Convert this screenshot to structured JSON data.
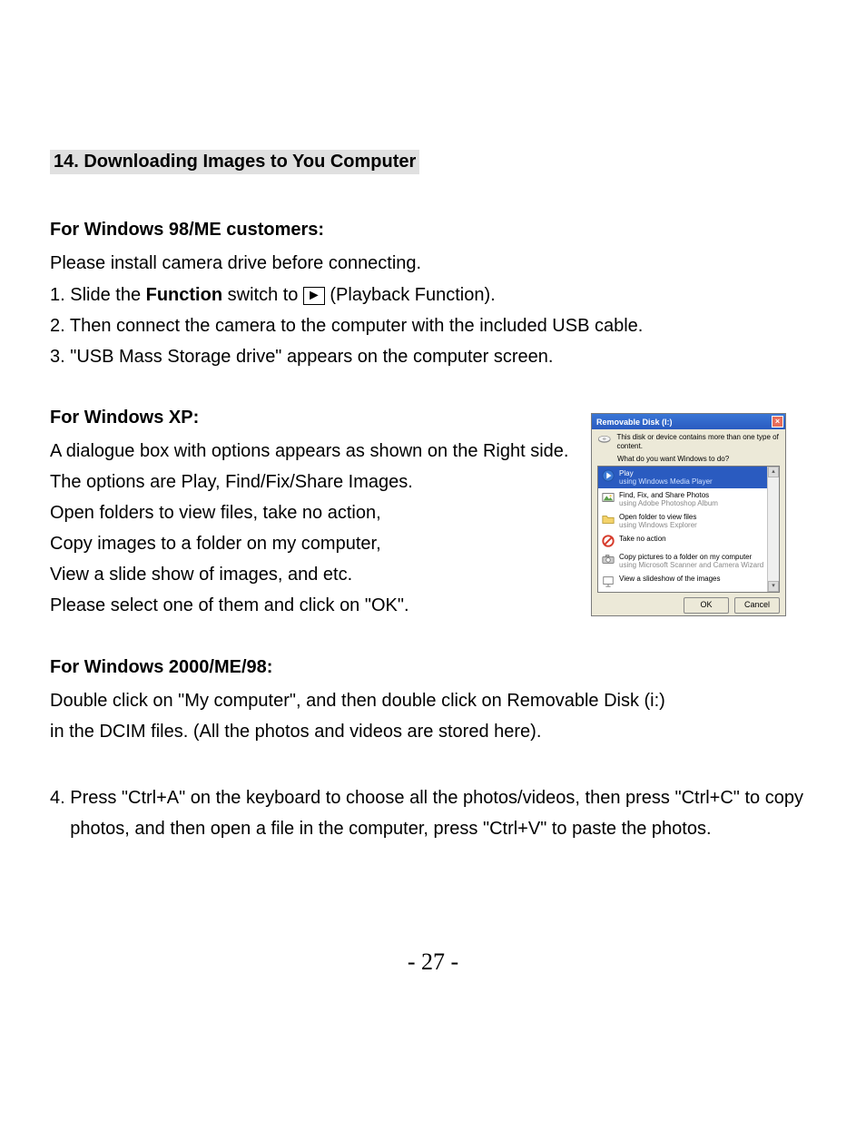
{
  "title": "14. Downloading Images to You Computer",
  "section_win98me": {
    "heading": "For Windows 98/ME customers:",
    "intro": "Please install camera drive before connecting.",
    "item1_prefix": "1. Slide the ",
    "item1_bold": "Function",
    "item1_mid": " switch to ",
    "item1_play_glyph": "►",
    "item1_suffix": " (Playback Function).",
    "item2": "2. Then connect the camera to the computer with the included USB cable.",
    "item3": "3. \"USB Mass Storage drive\" appears on the computer screen."
  },
  "section_xp": {
    "heading": "For Windows XP:",
    "lines": [
      "A dialogue box with options appears as shown on the Right side.",
      "The options are Play, Find/Fix/Share Images.",
      "Open folders to view files, take no action,",
      "Copy images to a folder on my computer,",
      "View a slide show of images, and etc.",
      "Please select one of them and click on \"OK\"."
    ]
  },
  "section_2000": {
    "heading": "For Windows 2000/ME/98:",
    "line1": "Double click on \"My computer\", and then double click on Removable Disk (i:)",
    "line2": "in the DCIM files. (All the photos and videos are stored here)."
  },
  "item4_line1": "4. Press \"Ctrl+A\" on the keyboard to choose all the photos/videos, then press \"Ctrl+C\" to copy",
  "item4_line2": "    photos, and then open a file in the computer, press \"Ctrl+V\" to paste the photos.",
  "page_number": "- 27 -",
  "dialog": {
    "title": "Removable Disk (I:)",
    "close_glyph": "×",
    "message": "This disk or device contains more than one type of content.",
    "prompt": "What do you want Windows to do?",
    "options": [
      {
        "title": "Play",
        "sub": "using Windows Media Player",
        "icon": "play-circle-icon",
        "selected": true
      },
      {
        "title": "Find, Fix, and Share Photos",
        "sub": "using Adobe Photoshop Album",
        "icon": "photo-icon",
        "selected": false
      },
      {
        "title": "Open folder to view files",
        "sub": "using Windows Explorer",
        "icon": "folder-icon",
        "selected": false
      },
      {
        "title": "Take no action",
        "sub": "",
        "icon": "no-action-icon",
        "selected": false
      },
      {
        "title": "Copy pictures to a folder on my computer",
        "sub": "using Microsoft Scanner and Camera Wizard",
        "icon": "camera-icon",
        "selected": false
      },
      {
        "title": "View a slideshow of the images",
        "sub": "",
        "icon": "slideshow-icon",
        "selected": false
      }
    ],
    "scroll_up": "▴",
    "scroll_down": "▾",
    "ok_label": "OK",
    "cancel_label": "Cancel"
  }
}
